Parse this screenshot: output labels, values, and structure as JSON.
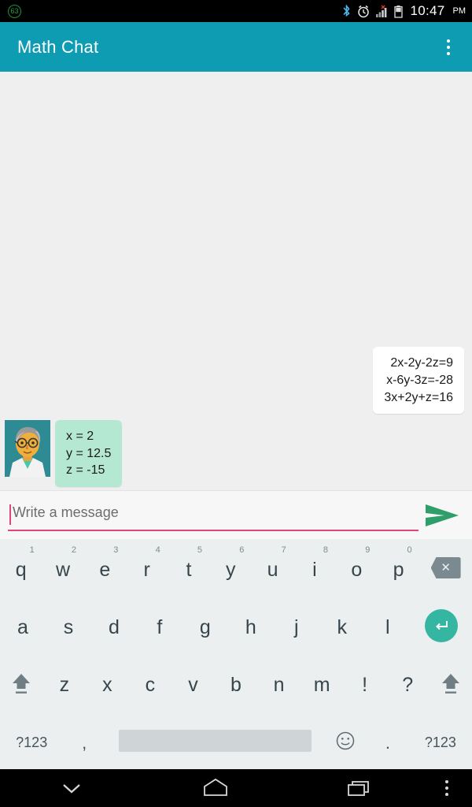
{
  "status_bar": {
    "left_badge": "63",
    "icons": [
      "bluetooth-icon",
      "alarm-icon",
      "signal-bars-icon",
      "battery-icon"
    ],
    "time": "10:47",
    "ampm": "PM"
  },
  "app_bar": {
    "title": "Math Chat",
    "overflow": "overflow-menu-icon"
  },
  "chat": {
    "messages": [
      {
        "side": "outgoing",
        "lines": [
          "2x-2y-2z=9",
          "x-6y-3z=-28",
          "3x+2y+z=16"
        ]
      },
      {
        "side": "incoming",
        "avatar": "professor-avatar",
        "lines": [
          "x = 2",
          "y = 12.5",
          "z = -15"
        ]
      }
    ]
  },
  "input_bar": {
    "placeholder": "Write a message",
    "value": "",
    "send_label": "send-icon"
  },
  "keyboard": {
    "row1": [
      {
        "key": "q",
        "num": "1"
      },
      {
        "key": "w",
        "num": "2"
      },
      {
        "key": "e",
        "num": "3"
      },
      {
        "key": "r",
        "num": "4"
      },
      {
        "key": "t",
        "num": "5"
      },
      {
        "key": "y",
        "num": "6"
      },
      {
        "key": "u",
        "num": "7"
      },
      {
        "key": "i",
        "num": "8"
      },
      {
        "key": "o",
        "num": "9"
      },
      {
        "key": "p",
        "num": "0"
      }
    ],
    "backspace": "backspace-key",
    "row2": [
      "a",
      "s",
      "d",
      "f",
      "g",
      "h",
      "j",
      "k",
      "l"
    ],
    "enter": "enter-key",
    "row3": [
      "z",
      "x",
      "c",
      "v",
      "b",
      "n",
      "m",
      "!",
      "?"
    ],
    "shift_left": "shift-key",
    "shift_right": "shift-key",
    "row4": {
      "symbols_left": "?123",
      "comma": ",",
      "space": "",
      "emoji": "emoji-key",
      "period": ".",
      "symbols_right": "?123"
    }
  },
  "nav_bar": {
    "back": "hide-keyboard-icon",
    "home": "home-icon",
    "recents": "recents-icon",
    "menu": "nav-menu-icon"
  },
  "colors": {
    "accent_teal": "#0d9cb2",
    "bubble_in": "#b4e8d2",
    "bubble_out": "#ffffff",
    "input_underline": "#e0457b",
    "send_green": "#2e9e6b",
    "enter_teal": "#35b6a3",
    "chat_bg": "#efefef"
  }
}
